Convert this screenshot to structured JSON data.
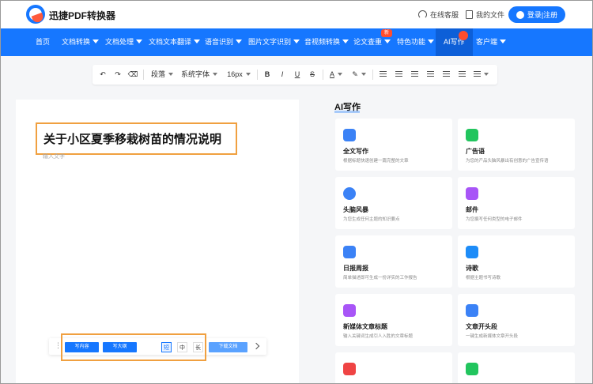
{
  "header": {
    "brand": "迅捷PDF转换器",
    "service": "在线客服",
    "my_files": "我的文件",
    "login": "登录|注册"
  },
  "nav": {
    "items": [
      {
        "label": "首页",
        "dropdown": false
      },
      {
        "label": "文档转换",
        "dropdown": true
      },
      {
        "label": "文档处理",
        "dropdown": true
      },
      {
        "label": "文档文本翻译",
        "dropdown": true
      },
      {
        "label": "语音识别",
        "dropdown": true
      },
      {
        "label": "图片文字识别",
        "dropdown": true
      },
      {
        "label": "音视频转换",
        "dropdown": true
      },
      {
        "label": "论文查重",
        "dropdown": true
      },
      {
        "label": "特色功能",
        "dropdown": true
      },
      {
        "label": "AI写作",
        "dropdown": false
      },
      {
        "label": "客户端",
        "dropdown": true
      }
    ],
    "new_badge": "新",
    "active": "AI写作"
  },
  "toolbar": {
    "paragraph": "段落",
    "font": "系统字体",
    "size": "16px",
    "bold": "B",
    "italic": "I",
    "underline": "U",
    "strike": "S",
    "font_color": "A"
  },
  "editor": {
    "title": "关于小区夏季移栽树苗的情况说明",
    "placeholder": "输入文字",
    "write_content": "写内容",
    "write_outline": "写大纲",
    "length_short": "短",
    "length_medium": "中",
    "length_long": "长",
    "length_selected": "短",
    "download": "下载文档"
  },
  "ai_panel": {
    "heading": "AI写作",
    "cards": [
      {
        "title": "全文写作",
        "desc": "根据标题快速创建一篇完整的文章",
        "icon": "document-icon",
        "color": "#3b82f6"
      },
      {
        "title": "广告语",
        "desc": "为您的产品头脑风暴出有创意的广告宣传语",
        "icon": "ad-icon",
        "color": "#22c55e"
      },
      {
        "title": "头脑风暴",
        "desc": "为您生成任何主题的知识要点",
        "icon": "lightning-icon",
        "color": "#3b82f6"
      },
      {
        "title": "邮件",
        "desc": "为您撰写任何类型的电子邮件",
        "icon": "mail-icon",
        "color": "#a855f7"
      },
      {
        "title": "日报周报",
        "desc": "简单描述即可生成一份详实的工作报告",
        "icon": "report-icon",
        "color": "#3b82f6"
      },
      {
        "title": "诗歌",
        "desc": "根据主题书写诗歌",
        "icon": "poem-icon",
        "color": "#1d8cf8"
      },
      {
        "title": "新媒体文章标题",
        "desc": "输入关键词生成引人入胜的文章标题",
        "icon": "pen-icon",
        "color": "#a855f7"
      },
      {
        "title": "文章开头段",
        "desc": "一键生成新媒体文章开头段",
        "icon": "edit-icon",
        "color": "#3b82f6"
      },
      {
        "title": "",
        "desc": "",
        "icon": "red-icon",
        "color": "#ef4444"
      },
      {
        "title": "",
        "desc": "",
        "icon": "green-icon",
        "color": "#22c55e"
      }
    ]
  }
}
